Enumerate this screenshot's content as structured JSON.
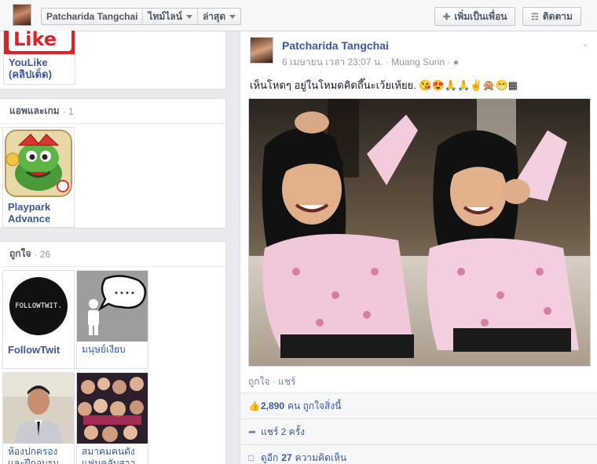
{
  "topbar": {
    "profile_name": "Patcharida Tangchai",
    "timeline_label": "ไทม์ไลน์",
    "recent_label": "ล่าสุด",
    "add_friend_label": "เพิ่มเป็นเพื่อน",
    "follow_label": "ติดตาม"
  },
  "left": {
    "top_app": {
      "label": "YouLike (คลิปเด็ด)",
      "logo_text": "Like"
    },
    "apps_section": {
      "title": "แอพและเกม",
      "count": "1"
    },
    "app_item": {
      "label": "Playpark Advance"
    },
    "likes_section": {
      "title": "ถูกใจ",
      "count": "26"
    },
    "likes": [
      {
        "label": "FollowTwit",
        "logo_text": "FOLLOWTWIT."
      },
      {
        "label": "มนุษย์เงียบ"
      },
      {
        "label": "ห้องปกครอง และฝึกอบรม"
      },
      {
        "label": "สมาคมคนดัง แฟนคลับสาว"
      }
    ]
  },
  "post": {
    "author": "Patcharida Tangchai",
    "timestamp": "6 เมษายน เวลา 23:07 น.",
    "location": "Muang Surin",
    "text": "เห็นโหดๆ อยู่ในโหมดคิดถึ๊นะเว้ยเห้ยย. 😘😍🙏🙏✌🙊😁▦",
    "like_action": "ถูกใจ",
    "share_action": "แชร์",
    "likes_count": "2,890",
    "likes_suffix": "คน ถูกใจสิ่งนี้",
    "shares_text": "แชร์ 2 ครั้ง",
    "more_comments_prefix": "ดูอีก",
    "more_comments_count": "27",
    "more_comments_suffix": "ความคิดเห็น"
  }
}
